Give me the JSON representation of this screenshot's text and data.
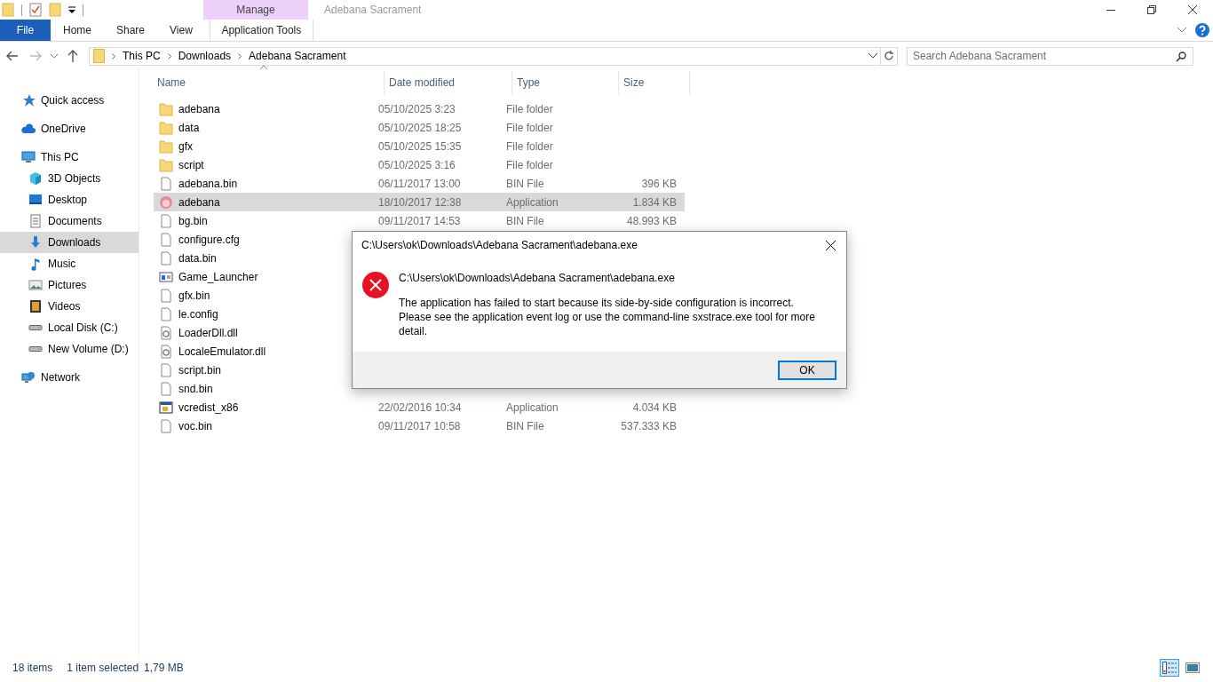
{
  "title_bar": {
    "context_tab": "Manage",
    "title": "Adebana Sacrament"
  },
  "ribbon_tabs": [
    {
      "label": "File",
      "kind": "file"
    },
    {
      "label": "Home",
      "kind": "tab"
    },
    {
      "label": "Share",
      "kind": "tab"
    },
    {
      "label": "View",
      "kind": "tab"
    },
    {
      "label": "Application Tools",
      "kind": "context"
    }
  ],
  "address_bar": {
    "crumbs": [
      "This PC",
      "Downloads",
      "Adebana Sacrament"
    ]
  },
  "search": {
    "placeholder": "Search Adebana Sacrament"
  },
  "sidebar": {
    "items": [
      {
        "label": "Quick access",
        "kind": "star",
        "selected": false
      },
      {
        "label": "OneDrive",
        "kind": "cloud",
        "selected": false
      },
      {
        "label": "This PC",
        "kind": "pc",
        "selected": false,
        "children": [
          {
            "label": "3D Objects",
            "kind": "cube",
            "selected": false
          },
          {
            "label": "Desktop",
            "kind": "desktop",
            "selected": false
          },
          {
            "label": "Documents",
            "kind": "docs",
            "selected": false
          },
          {
            "label": "Downloads",
            "kind": "download",
            "selected": true
          },
          {
            "label": "Music",
            "kind": "music",
            "selected": false
          },
          {
            "label": "Pictures",
            "kind": "pictures",
            "selected": false
          },
          {
            "label": "Videos",
            "kind": "videos",
            "selected": false
          },
          {
            "label": "Local Disk (C:)",
            "kind": "disk",
            "selected": false
          },
          {
            "label": "New Volume (D:)",
            "kind": "disk",
            "selected": false
          }
        ]
      },
      {
        "label": "Network",
        "kind": "network",
        "selected": false
      }
    ]
  },
  "table": {
    "columns": [
      "Name",
      "Date modified",
      "Type",
      "Size"
    ],
    "rows": [
      {
        "name": "adebana",
        "date": "05/10/2025 3:23",
        "type": "File folder",
        "kind": "folder",
        "selected": false
      },
      {
        "name": "data",
        "date": "05/10/2025 18:25",
        "type": "File folder",
        "kind": "folder",
        "selected": false
      },
      {
        "name": "gfx",
        "date": "05/10/2025 15:35",
        "type": "File folder",
        "kind": "folder",
        "selected": false
      },
      {
        "name": "script",
        "date": "05/10/2025 3:16",
        "type": "File folder",
        "kind": "folder",
        "selected": false
      },
      {
        "name": "adebana.bin",
        "date": "06/11/2017 13:00",
        "type": "BIN File",
        "size": "396 KB",
        "kind": "file",
        "selected": false
      },
      {
        "name": "adebana",
        "date": "18/10/2017 12:38",
        "type": "Application",
        "size": "1.834 KB",
        "kind": "app",
        "selected": true
      },
      {
        "name": "bg.bin",
        "date": "09/11/2017 14:53",
        "type": "BIN File",
        "size": "48.993 KB",
        "kind": "file",
        "selected": false
      },
      {
        "name": "configure.cfg",
        "kind": "file",
        "selected": false
      },
      {
        "name": "data.bin",
        "kind": "file",
        "selected": false
      },
      {
        "name": "Game_Launcher",
        "kind": "launcher",
        "selected": false
      },
      {
        "name": "gfx.bin",
        "kind": "file",
        "selected": false
      },
      {
        "name": "le.config",
        "kind": "file",
        "selected": false
      },
      {
        "name": "LoaderDll.dll",
        "kind": "dll",
        "selected": false
      },
      {
        "name": "LocaleEmulator.dll",
        "kind": "dll",
        "selected": false
      },
      {
        "name": "script.bin",
        "kind": "file",
        "selected": false
      },
      {
        "name": "snd.bin",
        "kind": "file",
        "selected": false
      },
      {
        "name": "vcredist_x86",
        "date": "22/02/2016 10:34",
        "type": "Application",
        "size": "4.034 KB",
        "kind": "installer",
        "selected": false
      },
      {
        "name": "voc.bin",
        "date": "09/11/2017 10:58",
        "type": "BIN File",
        "size": "537.333 KB",
        "kind": "file",
        "selected": false
      }
    ]
  },
  "status_bar": {
    "items": [
      "18 items",
      "1 item selected",
      "1,79 MB"
    ],
    "views": [
      {
        "kind": "details",
        "selected": true
      },
      {
        "kind": "large",
        "selected": false
      }
    ]
  },
  "dialog": {
    "title": "C:\\Users\\ok\\Downloads\\Adebana Sacrament\\adebana.exe",
    "heading": "C:\\Users\\ok\\Downloads\\Adebana Sacrament\\adebana.exe",
    "message": "The application has failed to start because its side-by-side configuration is incorrect. Please see the application event log or use the command-line sxstrace.exe tool for more detail.",
    "button": "OK"
  }
}
